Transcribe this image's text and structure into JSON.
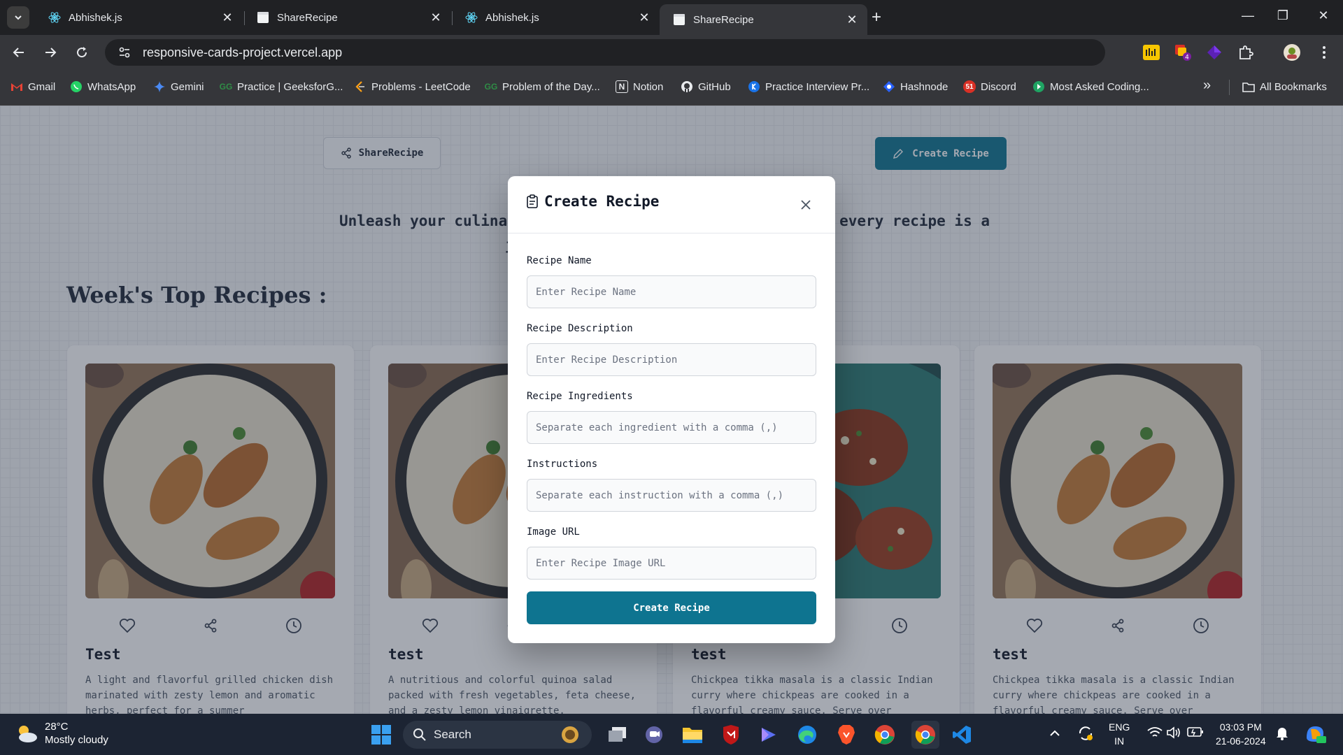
{
  "browser": {
    "tabs": [
      {
        "title": "Abhishek.js",
        "active": false,
        "icon": "react-icon"
      },
      {
        "title": "ShareRecipe",
        "active": false,
        "icon": "page-icon"
      },
      {
        "title": "Abhishek.js",
        "active": false,
        "icon": "react-icon"
      },
      {
        "title": "ShareRecipe",
        "active": true,
        "icon": "page-icon"
      }
    ],
    "url": "responsive-cards-project.vercel.app",
    "bookmarks": [
      {
        "label": "Gmail",
        "icon": "gmail-icon"
      },
      {
        "label": "WhatsApp",
        "icon": "whatsapp-icon"
      },
      {
        "label": "Gemini",
        "icon": "gemini-icon"
      },
      {
        "label": "Practice | GeeksforG...",
        "icon": "geeksforgeeks-icon"
      },
      {
        "label": "Problems - LeetCode",
        "icon": "leetcode-icon"
      },
      {
        "label": "Problem of the Day...",
        "icon": "geeksforgeeks-icon"
      },
      {
        "label": "Notion",
        "icon": "notion-icon"
      },
      {
        "label": "GitHub",
        "icon": "github-icon"
      },
      {
        "label": "Practice Interview Pr...",
        "icon": "interview-icon"
      },
      {
        "label": "Hashnode",
        "icon": "hashnode-icon"
      },
      {
        "label": "Discord",
        "icon": "discord-icon"
      },
      {
        "label": "Most Asked Coding...",
        "icon": "coding-icon"
      }
    ],
    "all_bookmarks": "All Bookmarks",
    "more_bookmarks": "»"
  },
  "page": {
    "brand": "ShareRecipe",
    "create_button": "Create Recipe",
    "tagline_line1": "Unleash your culinar",
    "tagline_line1_end": "every recipe is a",
    "tagline_line2_fragment": "j",
    "section_title": "Week's Top Recipes :",
    "cards": [
      {
        "title": "Test",
        "description": "A light and flavorful grilled chicken dish marinated with zesty lemon and aromatic herbs, perfect for a summer"
      },
      {
        "title": "test",
        "description": "A nutritious and colorful quinoa salad packed with fresh vegetables, feta cheese, and a zesty lemon vinaigrette."
      },
      {
        "title": "test",
        "description": "Chickpea tikka masala is a classic Indian curry where chickpeas are cooked in a flavorful creamy sauce. Serve over"
      },
      {
        "title": "test",
        "description": "Chickpea tikka masala is a classic Indian curry where chickpeas are cooked in a flavorful creamy sauce. Serve over"
      }
    ]
  },
  "modal": {
    "title": "Create Recipe",
    "fields": [
      {
        "label": "Recipe Name",
        "placeholder": "Enter Recipe Name",
        "value": ""
      },
      {
        "label": "Recipe Description",
        "placeholder": "Enter Recipe Description",
        "value": ""
      },
      {
        "label": "Recipe Ingredients",
        "placeholder": "Separate each ingredient with a comma (,)",
        "value": ""
      },
      {
        "label": "Instructions",
        "placeholder": "Separate each instruction with a comma (,)",
        "value": ""
      },
      {
        "label": "Image URL",
        "placeholder": "Enter Recipe Image URL",
        "value": ""
      }
    ],
    "submit": "Create Recipe"
  },
  "taskbar": {
    "temperature": "28°C",
    "weather": "Mostly cloudy",
    "search": "Search",
    "language_top": "ENG",
    "language_bottom": "IN",
    "time": "03:03 PM",
    "date": "21-06-2024"
  },
  "colors": {
    "accent": "#0e7490",
    "browser_dark": "#202124",
    "browser_toolbar": "#35363a",
    "taskbar": "#1c2433"
  }
}
